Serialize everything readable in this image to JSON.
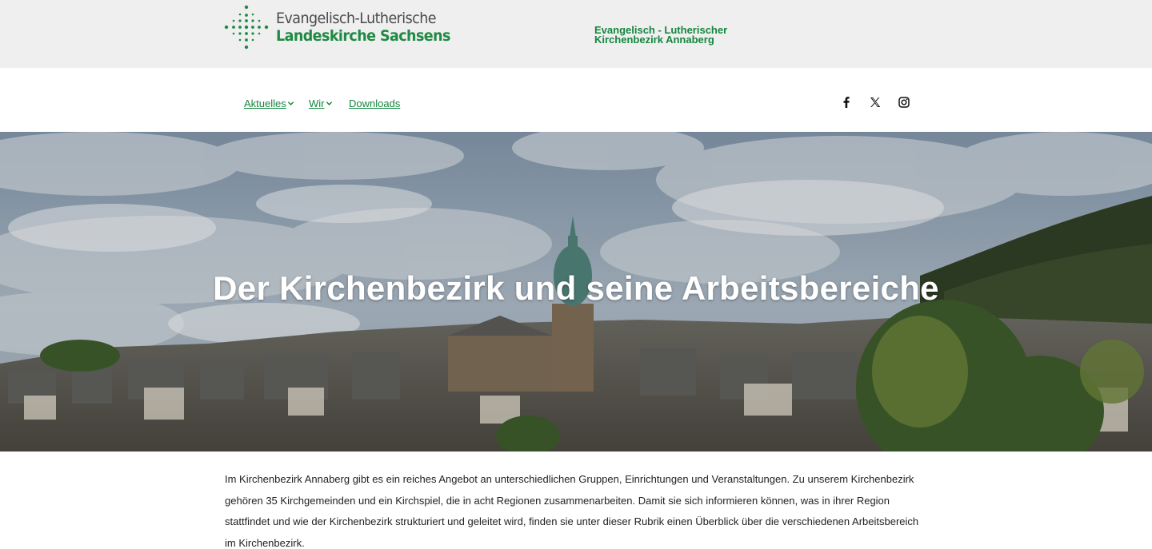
{
  "header": {
    "logo_line1": "Evangelisch-Lutherische",
    "logo_line2": "Landeskirche Sachsens",
    "district_line1": "Evangelisch - Lutherischer",
    "district_line2": "Kirchenbezirk Annaberg"
  },
  "nav": {
    "items": [
      {
        "label": "Aktuelles",
        "has_dropdown": true
      },
      {
        "label": "Wir",
        "has_dropdown": true
      },
      {
        "label": "Downloads",
        "has_dropdown": false
      }
    ],
    "social": [
      "facebook-icon",
      "x-icon",
      "instagram-icon"
    ]
  },
  "hero": {
    "title": "Der Kirchenbezirk und seine Arbeitsbereiche"
  },
  "content": {
    "intro": "Im Kirchenbezirk Annaberg gibt es ein reiches Angebot an unterschiedlichen Gruppen, Einrichtungen und Veranstaltungen. Zu unserem Kirchenbezirk gehören 35 Kirchgemeinden und ein Kirchspiel, die in acht Regionen zusammenarbeiten. Damit sie sich informieren können, was in ihrer Region stattfindet und wie der Kirchenbezirk strukturiert und geleitet wird, finden sie unter dieser Rubrik einen Überblick über die verschiedenen Arbeitsbereich im Kirchenbezirk."
  },
  "colors": {
    "brand_green": "#15863f",
    "header_bg": "#efefef"
  }
}
